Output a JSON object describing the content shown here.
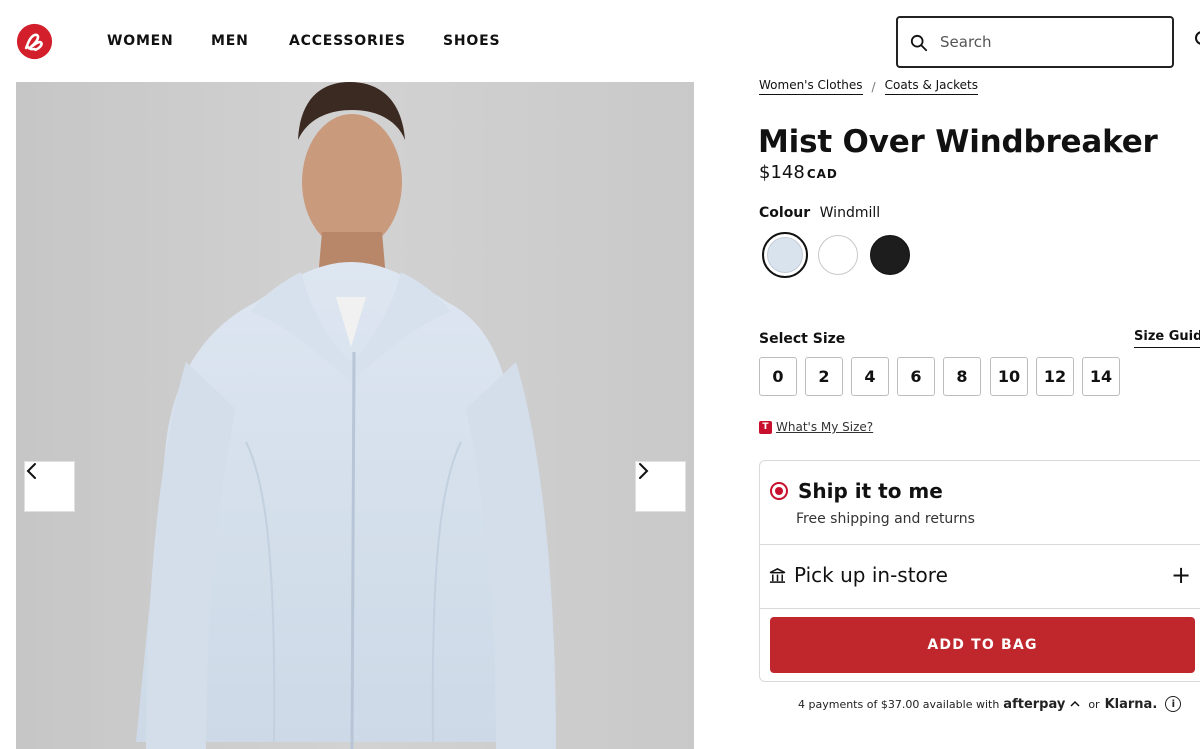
{
  "header": {
    "nav": [
      "WOMEN",
      "MEN",
      "ACCESSORIES",
      "SHOES"
    ],
    "search_placeholder": "Search"
  },
  "product": {
    "breadcrumbs": [
      "Women's Clothes",
      "Coats & Jackets"
    ],
    "breadcrumb_separator": "/",
    "title": "Mist Over Windbreaker",
    "price": "$148",
    "currency": "CAD",
    "colour_label": "Colour",
    "colour_value": "Windmill",
    "swatches": [
      {
        "name": "Windmill",
        "color": "#d9e3ee",
        "selected": true
      },
      {
        "name": "White",
        "color": "#ffffff",
        "selected": false
      },
      {
        "name": "Black",
        "color": "#1d1d1d",
        "selected": false
      }
    ],
    "size_label": "Select Size",
    "size_guide": "Size Guide",
    "sizes": [
      "0",
      "2",
      "4",
      "6",
      "8",
      "10",
      "12",
      "14"
    ],
    "fit_link": "What's My Size?",
    "fit_icon": "T"
  },
  "fulfilment": {
    "ship_title": "Ship it to me",
    "ship_sub": "Free shipping and returns",
    "pickup_title": "Pick up in-store",
    "pickup_toggle": "+",
    "add_to_bag": "ADD TO BAG"
  },
  "payments": {
    "text": "4 payments of $37.00 available with",
    "afterpay": "afterpay",
    "or": "or",
    "klarna": "Klarna.",
    "info": "i"
  },
  "colors": {
    "brand_red": "#c0272d",
    "radio_red": "#c8102e"
  }
}
